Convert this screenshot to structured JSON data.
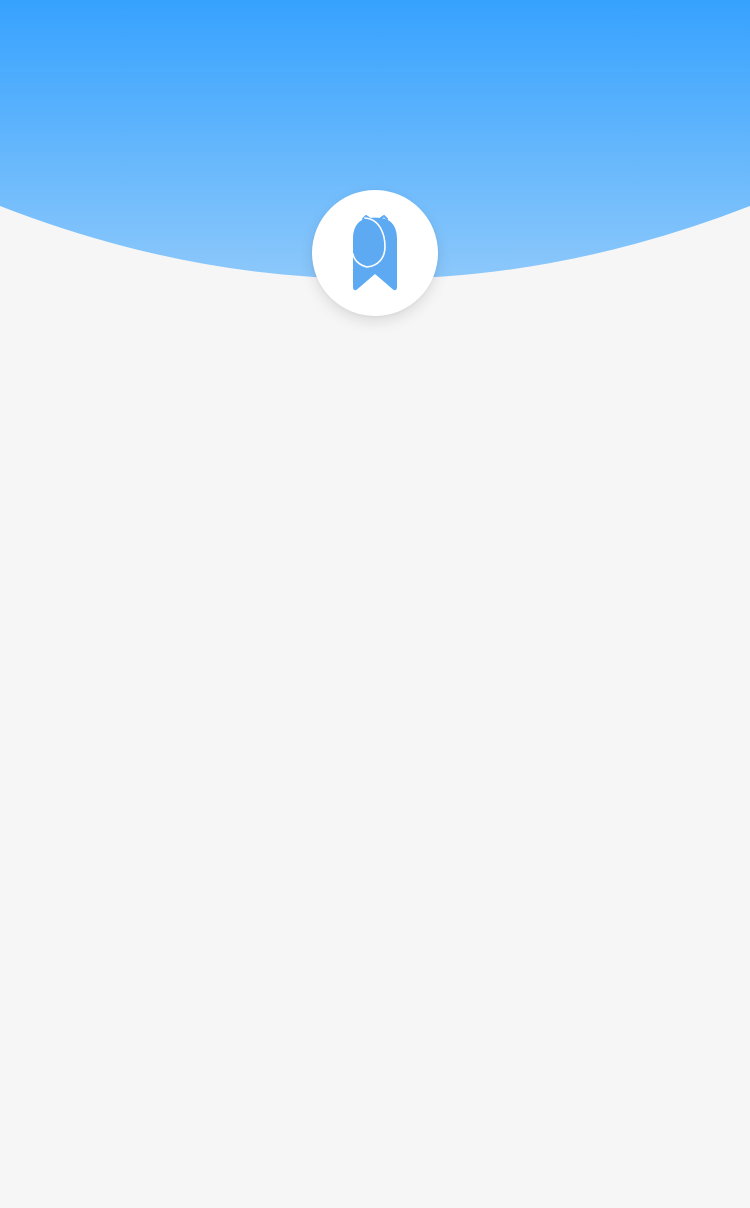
{
  "colors": {
    "header_gradient_top": "#36a2fe",
    "header_gradient_bottom": "#8cc8fb",
    "page_background": "#f6f6f6",
    "logo_circle": "#ffffff",
    "logo_mark": "#5daaf3"
  },
  "header": {
    "logo": {
      "icon": "ribbon-bookmark-logo-icon"
    }
  }
}
